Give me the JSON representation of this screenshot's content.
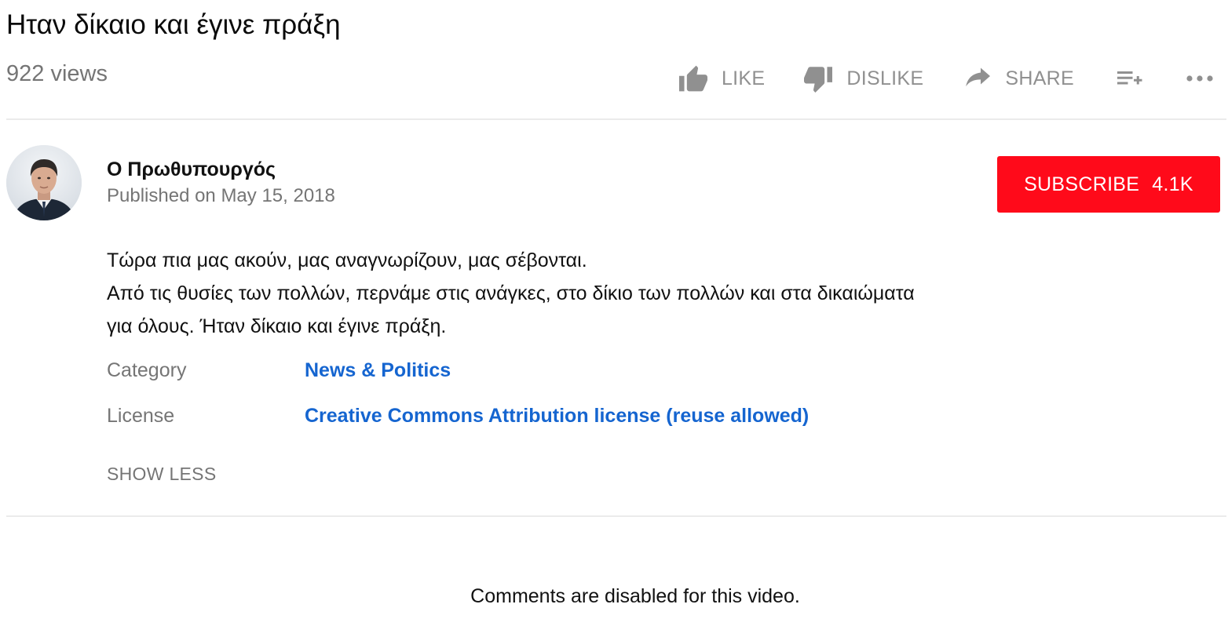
{
  "video": {
    "title": "Ηταν δίκαιο και έγινε πράξη",
    "views": "922 views"
  },
  "actions": {
    "like_label": "LIKE",
    "dislike_label": "DISLIKE",
    "share_label": "SHARE",
    "save_icon": "add-to-playlist-icon",
    "more_icon": "more-horizontal-icon"
  },
  "channel": {
    "name": "Ο Πρωθυπουργός",
    "published": "Published on May 15, 2018",
    "subscribe_label": "SUBSCRIBE",
    "subscriber_count": "4.1K",
    "subscribe_color": "#ff0a1a"
  },
  "description": {
    "lines": [
      "Τώρα πια μας ακούν, μας αναγνωρίζουν, μας σέβονται.",
      "Από τις θυσίες των πολλών, περνάμε στις ανάγκες, στο δίκιο των πολλών και στα δικαιώματα",
      "για όλους. Ήταν δίκαιο και έγινε πράξη."
    ]
  },
  "metadata": {
    "category_label": "Category",
    "category_value": "News & Politics",
    "license_label": "License",
    "license_value": "Creative Commons Attribution license (reuse allowed)",
    "link_color": "#1565d0"
  },
  "show_less_label": "SHOW LESS",
  "comments_status": "Comments are disabled for this video."
}
